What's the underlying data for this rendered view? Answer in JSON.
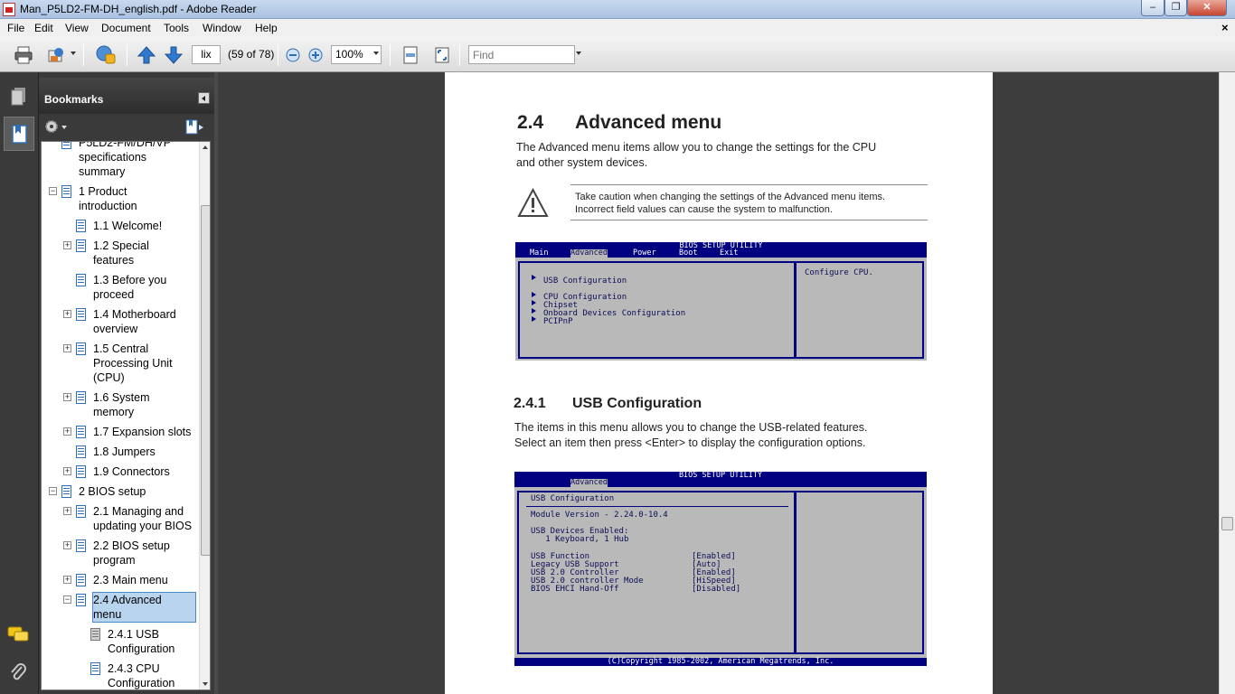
{
  "window": {
    "title": "Man_P5LD2-FM-DH_english.pdf - Adobe Reader",
    "min_glyph": "‒",
    "max_glyph": "❐",
    "close_glyph": "✕"
  },
  "menu": [
    "File",
    "Edit",
    "View",
    "Document",
    "Tools",
    "Window",
    "Help"
  ],
  "menu_close_glyph": "×",
  "toolbar": {
    "page_field": "lix",
    "page_count": "(59 of 78)",
    "zoom": "100%",
    "find_placeholder": "Find"
  },
  "colors": {
    "bios_blue": "#000080",
    "bios_gray": "#b9b9b9",
    "selection": "#b8d4ee"
  },
  "bookmarks": {
    "title": "Bookmarks",
    "items": [
      {
        "label": "P5LD2-FM/DH/VP\nspecifications\nsummary",
        "level": 0,
        "expander": "",
        "selected": false
      },
      {
        "label": "1  Product\nintroduction",
        "level": 0,
        "expander": "−",
        "selected": false
      },
      {
        "label": "1.1 Welcome!",
        "level": 1,
        "expander": "",
        "selected": false
      },
      {
        "label": "1.2 Special\nfeatures",
        "level": 1,
        "expander": "+",
        "selected": false
      },
      {
        "label": "1.3 Before you\nproceed",
        "level": 1,
        "expander": "",
        "selected": false
      },
      {
        "label": "1.4 Motherboard\noverview",
        "level": 1,
        "expander": "+",
        "selected": false
      },
      {
        "label": "1.5 Central\nProcessing Unit\n(CPU)",
        "level": 1,
        "expander": "+",
        "selected": false
      },
      {
        "label": "1.6 System\nmemory",
        "level": 1,
        "expander": "+",
        "selected": false
      },
      {
        "label": "1.7 Expansion slots",
        "level": 1,
        "expander": "+",
        "selected": false
      },
      {
        "label": "1.8 Jumpers",
        "level": 1,
        "expander": "",
        "selected": false
      },
      {
        "label": "1.9 Connectors",
        "level": 1,
        "expander": "+",
        "selected": false
      },
      {
        "label": "2 BIOS setup",
        "level": 0,
        "expander": "−",
        "selected": false
      },
      {
        "label": "2.1 Managing and\nupdating your BIOS",
        "level": 1,
        "expander": "+",
        "selected": false
      },
      {
        "label": "2.2 BIOS setup\nprogram",
        "level": 1,
        "expander": "+",
        "selected": false
      },
      {
        "label": "2.3 Main menu",
        "level": 1,
        "expander": "+",
        "selected": false
      },
      {
        "label": "2.4 Advanced\nmenu",
        "level": 1,
        "expander": "−",
        "selected": true
      },
      {
        "label": "2.4.1 USB\nConfiguration",
        "level": 2,
        "expander": "",
        "selected": false,
        "gray": true
      },
      {
        "label": "2.4.3 CPU\nConfiguration",
        "level": 2,
        "expander": "",
        "selected": false
      }
    ]
  },
  "page": {
    "section_num": "2.4",
    "section_title": "Advanced menu",
    "intro": "The Advanced menu items allow you to change the settings for the CPU\nand other system devices.",
    "caution": "Take caution when changing the settings of the Advanced menu items.\nIncorrect field values can cause the system to malfunction.",
    "bios1": {
      "title": "BIOS SETUP UTILITY",
      "tabs": [
        "Main",
        "Advanced",
        "Power",
        "Boot",
        "Exit"
      ],
      "active_tab": "Advanced",
      "items": [
        "USB Configuration",
        "CPU Configuration",
        "Chipset",
        "Onboard Devices Configuration",
        "PCIPnP"
      ],
      "help": "Configure CPU."
    },
    "sub_num": "2.4.1",
    "sub_title": "USB Configuration",
    "sub_intro": "The items in this menu allows you to change the USB-related features.\nSelect an item then press <Enter> to display the configuration options.",
    "bios2": {
      "title": "BIOS SETUP UTILITY",
      "active_tab": "Advanced",
      "header": "USB Configuration",
      "module": "Module Version - 2.24.0-10.4",
      "devices_label": "USB Devices Enabled:",
      "devices_value": "   1 Keyboard, 1 Hub",
      "settings": [
        {
          "name": "USB Function",
          "value": "[Enabled]"
        },
        {
          "name": "Legacy USB Support",
          "value": "[Auto]"
        },
        {
          "name": "USB 2.0 Controller",
          "value": "[Enabled]"
        },
        {
          "name": "USB 2.0 controller Mode",
          "value": "[HiSpeed]"
        },
        {
          "name": "BIOS EHCI Hand-Off",
          "value": "[Disabled]"
        }
      ],
      "footer": "(C)Copyright 1985-2002, American Megatrends, Inc."
    }
  }
}
